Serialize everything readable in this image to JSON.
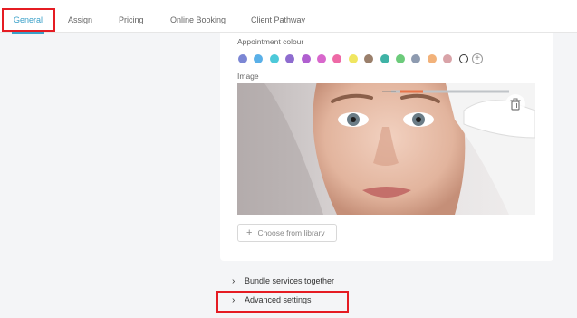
{
  "tabs": [
    {
      "label": "General",
      "active": true
    },
    {
      "label": "Assign",
      "active": false
    },
    {
      "label": "Pricing",
      "active": false
    },
    {
      "label": "Online Booking",
      "active": false
    },
    {
      "label": "Client Pathway",
      "active": false
    }
  ],
  "appointment_colour": {
    "label": "Appointment colour",
    "swatches": [
      "#7b86d4",
      "#5ab0e8",
      "#4dc9d9",
      "#8e6ccf",
      "#b05fd0",
      "#d867cc",
      "#ee6aa6",
      "#f0e660",
      "#9a7f6b",
      "#3fb3a6",
      "#6ccb7b",
      "#8e9bb0",
      "#f2b27a",
      "#d9a3a8",
      "#ffffff"
    ],
    "selected": "#ffffff",
    "add_icon": "plus-circle-icon"
  },
  "image": {
    "label": "Image",
    "delete_icon": "trash-icon",
    "choose_library_label": "Choose from library"
  },
  "sections": {
    "bundle_label": "Bundle services together",
    "advanced_label": "Advanced settings",
    "chevron_icon": "chevron-right-icon"
  },
  "colors": {
    "accent": "#3aa0c8",
    "highlight": "#e51c23"
  }
}
